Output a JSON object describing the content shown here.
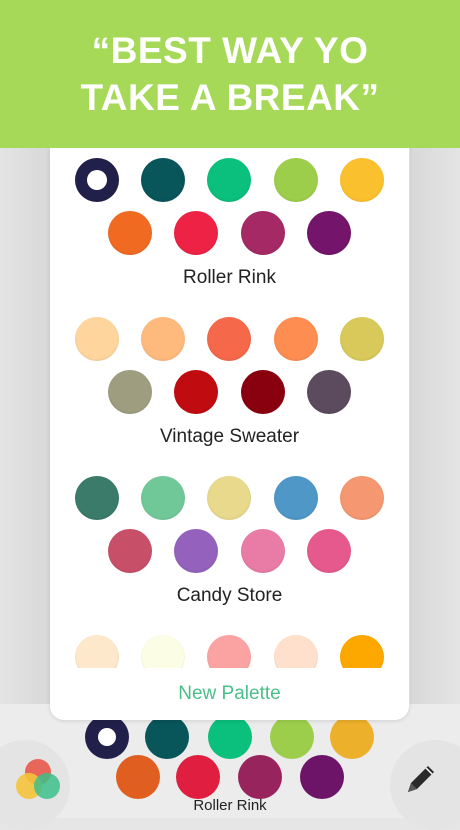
{
  "banner": {
    "headline": "“BEST WAY YO\nTAKE A BREAK”"
  },
  "palettes": [
    {
      "name": "Roller Rink",
      "rows": [
        [
          "#20204a",
          "#08555a",
          "#0bbf7d",
          "#9cce4c",
          "#fbc02d"
        ],
        [
          "#f06a22",
          "#ee2244",
          "#a52964",
          "#74146b"
        ]
      ],
      "selected_index": 0
    },
    {
      "name": "Vintage Sweater",
      "rows": [
        [
          "#fed59d",
          "#feb97d",
          "#f5684a",
          "#fd8d50",
          "#d9c95b"
        ],
        [
          "#9f9d7f",
          "#c00b11",
          "#89000e",
          "#5c4a5e"
        ]
      ]
    },
    {
      "name": "Candy Store",
      "rows": [
        [
          "#3b7b69",
          "#70c898",
          "#e8d98c",
          "#4e97c6",
          "#f59770"
        ],
        [
          "#c84f68",
          "#9462bd",
          "#e97ba7",
          "#e6598c"
        ]
      ]
    },
    {
      "name": "",
      "rows": [
        [
          "#fde8cc",
          "#fcfde5",
          "#fba3a3",
          "#ffe0cc",
          "#fda800"
        ]
      ]
    }
  ],
  "new_palette_label": "New Palette",
  "bottom_bar": {
    "label": "Roller Rink",
    "rows": [
      [
        "#20204a",
        "#08555a",
        "#0bbf7d",
        "#9cce4c",
        "#ecb02a"
      ],
      [
        "#e05e20",
        "#e01e40",
        "#97245c",
        "#6d1368"
      ]
    ],
    "selected_index": 0
  },
  "icons": {
    "left": "palette-icon",
    "right": "pencil-icon"
  }
}
